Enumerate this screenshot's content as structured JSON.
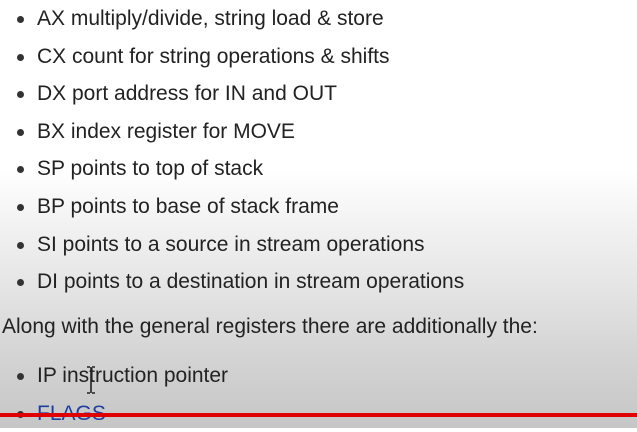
{
  "registers_list": [
    "AX multiply/divide, string load & store",
    "CX count for string operations & shifts",
    "DX port address for IN and OUT",
    "BX index register for MOVE",
    "SP points to top of stack",
    "BP points to base of stack frame",
    "SI points to a source in stream operations",
    "DI points to a destination in stream operations"
  ],
  "paragraph": "Along with the general registers there are additionally the:",
  "additional_list": {
    "ip": "IP instruction pointer",
    "flags": "FLAGS"
  },
  "colors": {
    "text": "#222222",
    "link": "#1f3fa0",
    "progress_line": "#e00000"
  },
  "icons": {
    "cursor": "text-cursor-icon"
  }
}
